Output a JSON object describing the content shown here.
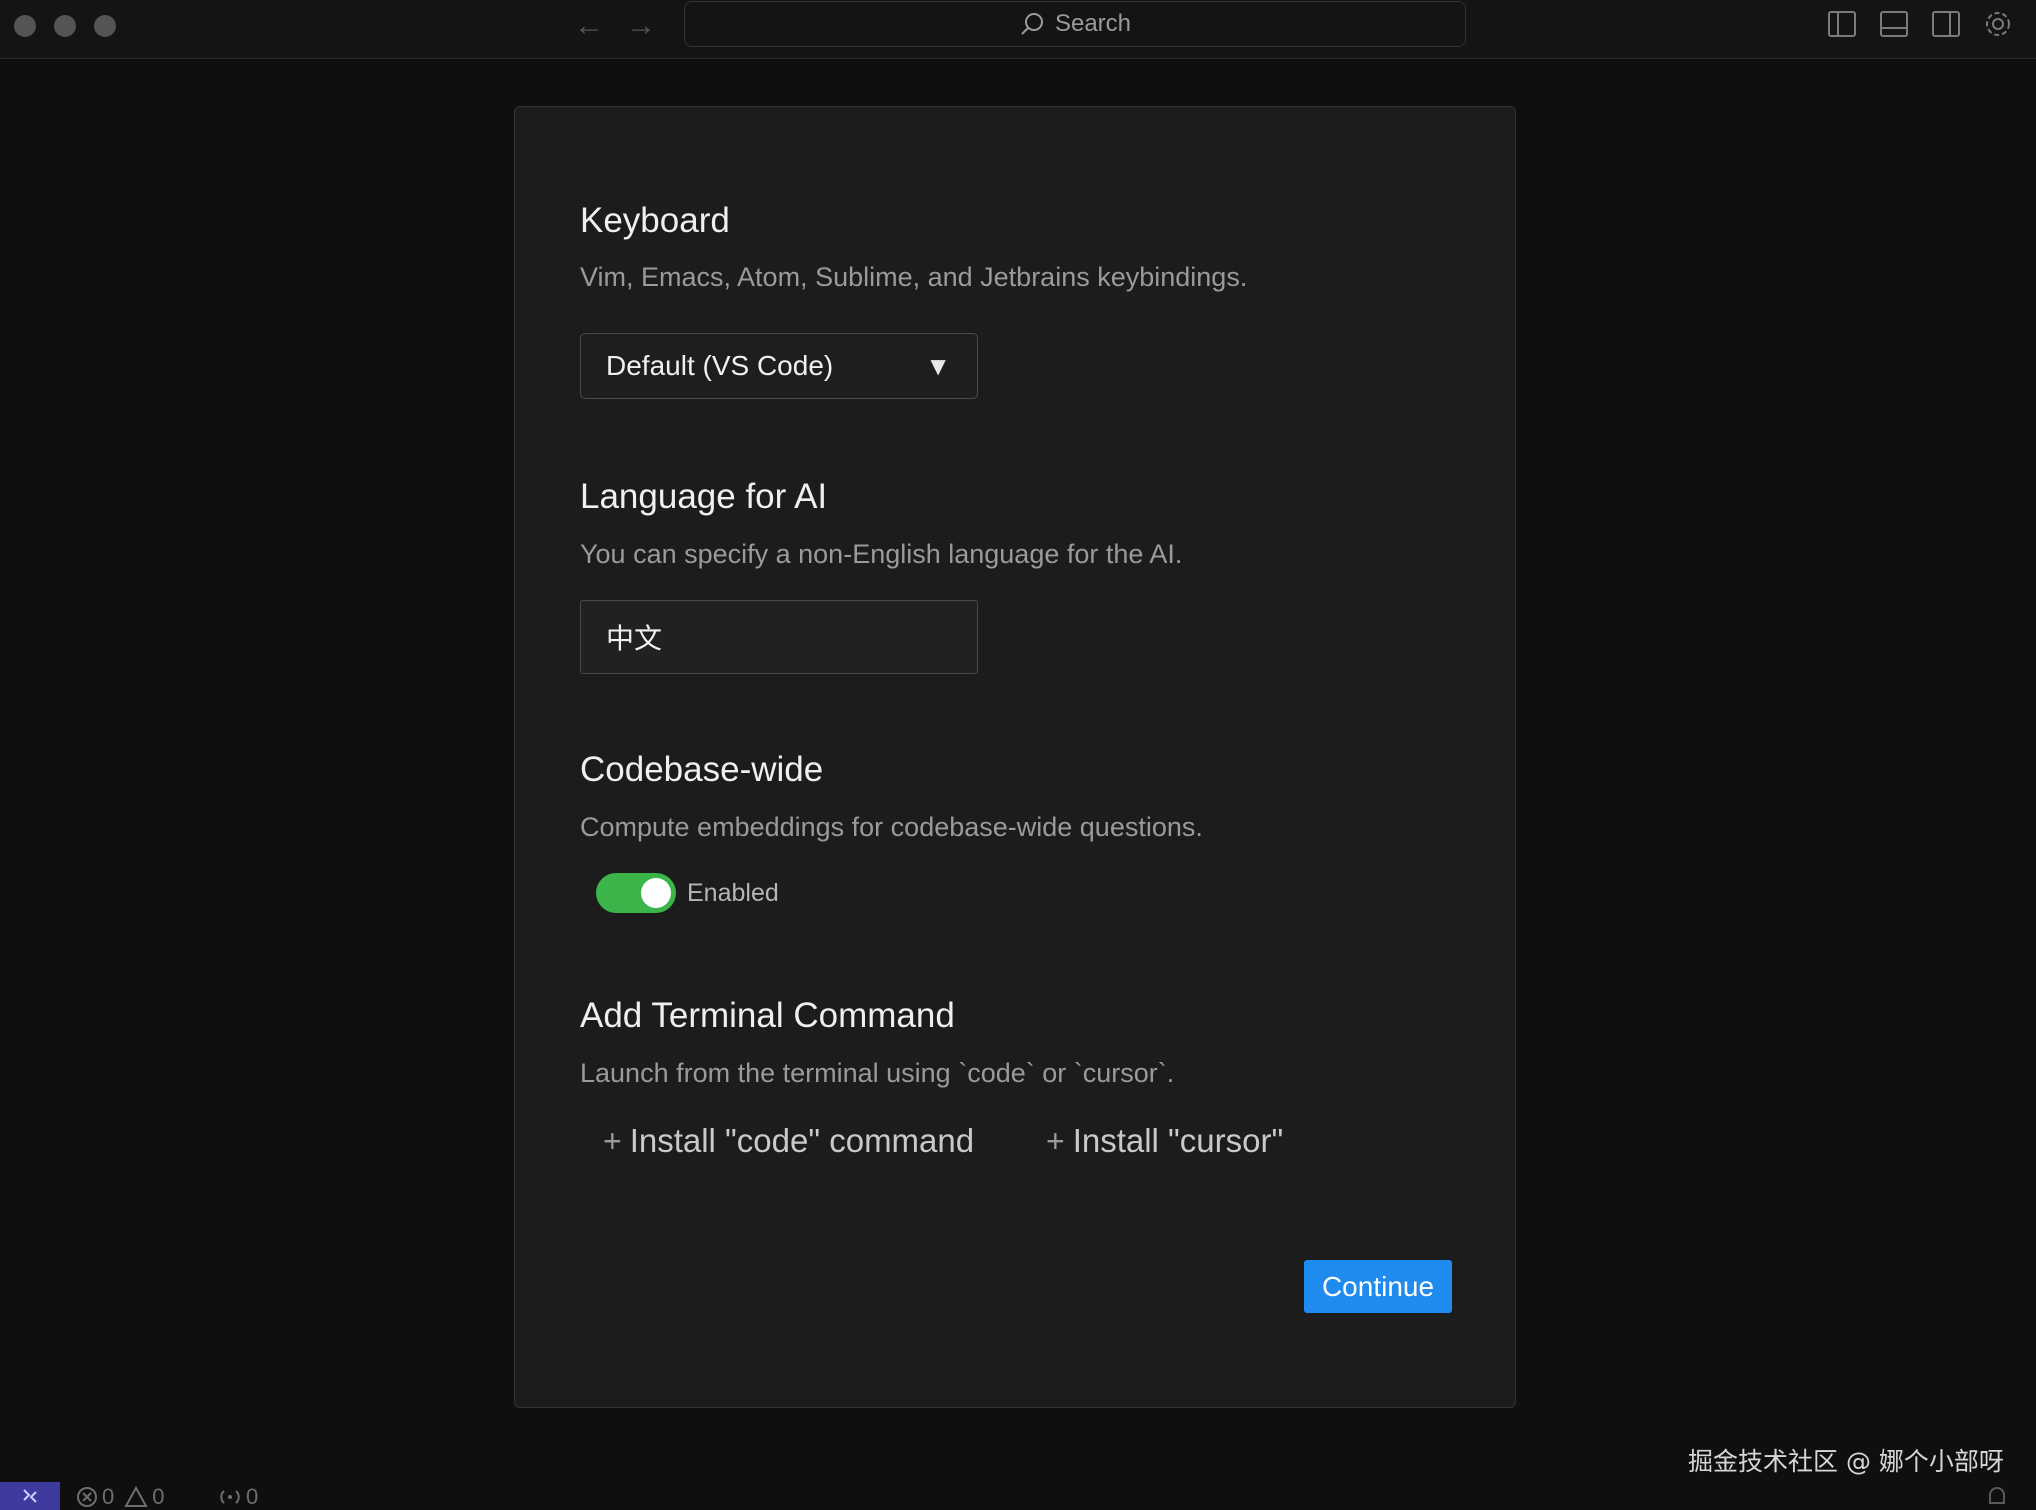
{
  "titlebar": {
    "search_placeholder": "Search"
  },
  "keyboard": {
    "title": "Keyboard",
    "description": "Vim, Emacs, Atom, Sublime, and Jetbrains keybindings.",
    "selected": "Default (VS Code)"
  },
  "language": {
    "title": "Language for AI",
    "description": "You can specify a non-English language for the AI.",
    "value": "中文"
  },
  "codebase": {
    "title": "Codebase-wide",
    "description": "Compute embeddings for codebase-wide questions.",
    "toggle_label": "Enabled",
    "enabled": true
  },
  "terminal": {
    "title": "Add Terminal Command",
    "description": "Launch from the terminal using `code` or `cursor`.",
    "install_code": "Install \"code\" command",
    "install_cursor": "Install \"cursor\""
  },
  "actions": {
    "continue": "Continue"
  },
  "watermark": "掘金技术社区 @ 娜个小部呀",
  "statusbar": {
    "errors": "0",
    "warnings": "0",
    "ports": "0"
  },
  "colors": {
    "accent": "#1f8bee",
    "toggle_on": "#3bb54a",
    "remote": "#3d3a9e"
  }
}
